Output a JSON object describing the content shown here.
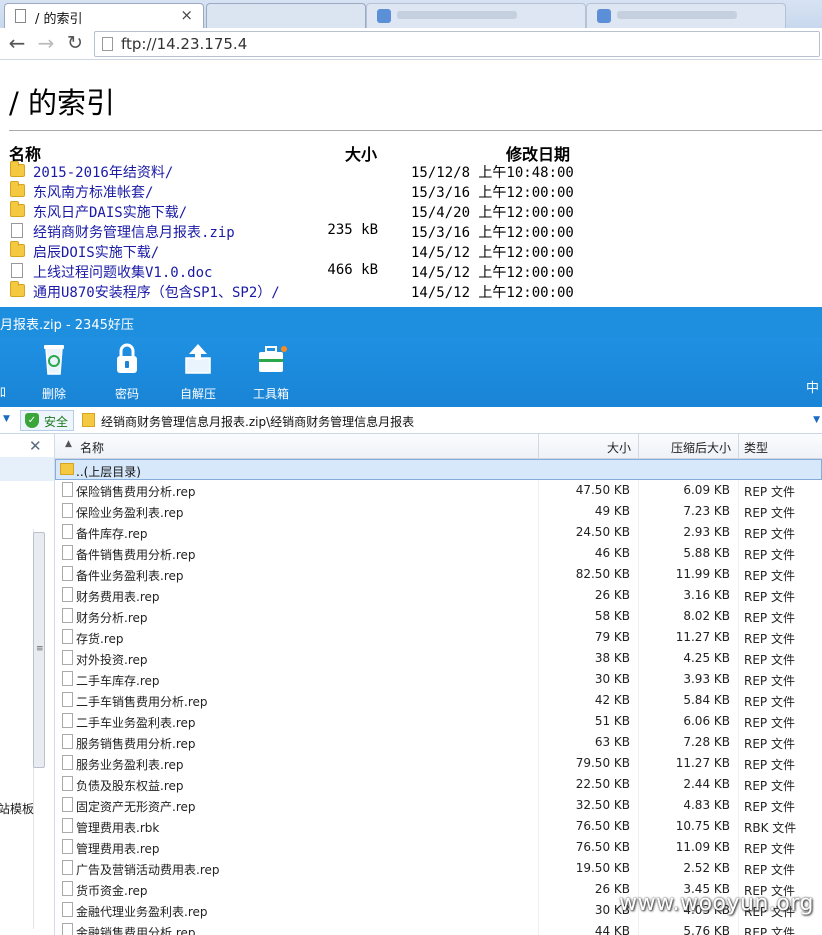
{
  "browser": {
    "tab_active_title": "/ 的索引",
    "tab_close": "×",
    "url": "ftp://14.23.175.4"
  },
  "ftp": {
    "heading": "/  的索引",
    "columns": {
      "name": "名称",
      "size": "大小",
      "modified": "修改日期"
    },
    "rows": [
      {
        "type": "folder",
        "name": "2015-2016年结资料/",
        "size": "",
        "date": "15/12/8 上午10:48:00"
      },
      {
        "type": "folder",
        "name": "东风南方标准帐套/",
        "size": "",
        "date": "15/3/16 上午12:00:00"
      },
      {
        "type": "folder",
        "name": "东风日产DAIS实施下载/",
        "size": "",
        "date": "15/4/20 上午12:00:00"
      },
      {
        "type": "file",
        "name": "经销商财务管理信息月报表.zip",
        "size": "235 kB",
        "date": "15/3/16 上午12:00:00"
      },
      {
        "type": "folder",
        "name": "启辰DOIS实施下载/",
        "size": "",
        "date": "14/5/12 上午12:00:00"
      },
      {
        "type": "file",
        "name": "上线过程问题收集V1.0.doc",
        "size": "466 kB",
        "date": "14/5/12 上午12:00:00"
      },
      {
        "type": "folder",
        "name": "通用U870安装程序（包含SP1、SP2）/",
        "size": "",
        "date": "14/5/12 上午12:00:00"
      }
    ]
  },
  "zip": {
    "window_title": "月报表.zip - 2345好压",
    "ribbon": {
      "left_cut": "加",
      "delete": "删除",
      "password": "密码",
      "self_extract": "自解压",
      "toolbox": "工具箱",
      "lang": "中"
    },
    "safe_label": "安全",
    "path": "经销商财务管理信息月报表.zip\\经销商财务管理信息月报表",
    "left_cut_text": "网站模板",
    "columns": {
      "name": "名称",
      "size": "大小",
      "packed": "压缩后大小",
      "type": "类型"
    },
    "updir": "..(上层目录)",
    "files": [
      {
        "name": "保险销售费用分析.rep",
        "size": "47.50 KB",
        "packed": "6.09 KB",
        "type": "REP 文件"
      },
      {
        "name": "保险业务盈利表.rep",
        "size": "49 KB",
        "packed": "7.23 KB",
        "type": "REP 文件"
      },
      {
        "name": "备件库存.rep",
        "size": "24.50 KB",
        "packed": "2.93 KB",
        "type": "REP 文件"
      },
      {
        "name": "备件销售费用分析.rep",
        "size": "46 KB",
        "packed": "5.88 KB",
        "type": "REP 文件"
      },
      {
        "name": "备件业务盈利表.rep",
        "size": "82.50 KB",
        "packed": "11.99 KB",
        "type": "REP 文件"
      },
      {
        "name": "财务费用表.rep",
        "size": "26 KB",
        "packed": "3.16 KB",
        "type": "REP 文件"
      },
      {
        "name": "财务分析.rep",
        "size": "58 KB",
        "packed": "8.02 KB",
        "type": "REP 文件"
      },
      {
        "name": "存货.rep",
        "size": "79 KB",
        "packed": "11.27 KB",
        "type": "REP 文件"
      },
      {
        "name": "对外投资.rep",
        "size": "38 KB",
        "packed": "4.25 KB",
        "type": "REP 文件"
      },
      {
        "name": "二手车库存.rep",
        "size": "30 KB",
        "packed": "3.93 KB",
        "type": "REP 文件"
      },
      {
        "name": "二手车销售费用分析.rep",
        "size": "42 KB",
        "packed": "5.84 KB",
        "type": "REP 文件"
      },
      {
        "name": "二手车业务盈利表.rep",
        "size": "51 KB",
        "packed": "6.06 KB",
        "type": "REP 文件"
      },
      {
        "name": "服务销售费用分析.rep",
        "size": "63 KB",
        "packed": "7.28 KB",
        "type": "REP 文件"
      },
      {
        "name": "服务业务盈利表.rep",
        "size": "79.50 KB",
        "packed": "11.27 KB",
        "type": "REP 文件"
      },
      {
        "name": "负债及股东权益.rep",
        "size": "22.50 KB",
        "packed": "2.44 KB",
        "type": "REP 文件"
      },
      {
        "name": "固定资产无形资产.rep",
        "size": "32.50 KB",
        "packed": "4.83 KB",
        "type": "REP 文件"
      },
      {
        "name": "管理费用表.rbk",
        "size": "76.50 KB",
        "packed": "10.75 KB",
        "type": "RBK 文件"
      },
      {
        "name": "管理费用表.rep",
        "size": "76.50 KB",
        "packed": "11.09 KB",
        "type": "REP 文件"
      },
      {
        "name": "广告及营销活动费用表.rep",
        "size": "19.50 KB",
        "packed": "2.52 KB",
        "type": "REP 文件"
      },
      {
        "name": "货币资金.rep",
        "size": "26 KB",
        "packed": "3.45 KB",
        "type": "REP 文件"
      },
      {
        "name": "金融代理业务盈利表.rep",
        "size": "30 KB",
        "packed": "4.03 KB",
        "type": "REP 文件"
      },
      {
        "name": "金融销售费用分析.rep",
        "size": "44 KB",
        "packed": "5.76 KB",
        "type": "REP 文件"
      }
    ]
  },
  "watermark": "www.wooyun.org",
  "colors": {
    "zip_blue": "#1e8ede",
    "link": "#1a1aa6",
    "folder": "#f5c842"
  }
}
